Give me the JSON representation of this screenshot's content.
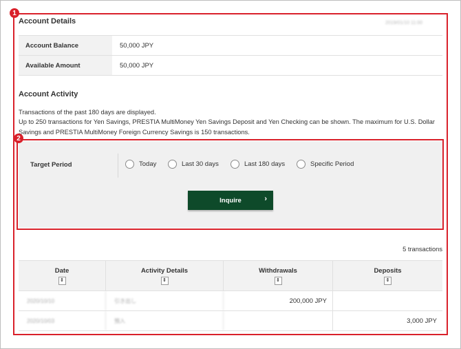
{
  "account_details": {
    "heading": "Account Details",
    "timestamp": "2019/01/10 11:00",
    "rows": [
      {
        "label": "Account Balance",
        "value": "50,000 JPY"
      },
      {
        "label": "Available Amount",
        "value": "50,000 JPY"
      }
    ]
  },
  "account_activity": {
    "heading": "Account Activity",
    "info_lines": [
      "Transactions of the past 180 days are displayed.",
      "Up to 250 transactions for Yen Savings, PRESTIA MultiMoney Yen Savings Deposit and Yen Checking can be shown. The maximum for U.S. Dollar Savings and PRESTIA MultiMoney Foreign Currency Savings is 150 transactions."
    ]
  },
  "filter": {
    "target_period_label": "Target Period",
    "options": [
      "Today",
      "Last 30 days",
      "Last 180 days",
      "Specific Period"
    ],
    "inquire_label": "Inquire",
    "inquire_arrow": "›"
  },
  "transactions": {
    "count_text": "5 transactions",
    "columns": [
      "Date",
      "Activity Details",
      "Withdrawals",
      "Deposits"
    ],
    "sort_glyph": "⇕",
    "rows": [
      {
        "date": "2020/10/10",
        "details": "引き出し",
        "withdrawal": "200,000 JPY",
        "deposit": ""
      },
      {
        "date": "2020/10/03",
        "details": "預入",
        "withdrawal": "",
        "deposit": "3,000 JPY"
      }
    ]
  },
  "callouts": [
    "1",
    "2"
  ],
  "colors": {
    "accent_red": "#d9202a",
    "button_green": "#0e4a2a",
    "panel_gray": "#f0f0f0"
  }
}
